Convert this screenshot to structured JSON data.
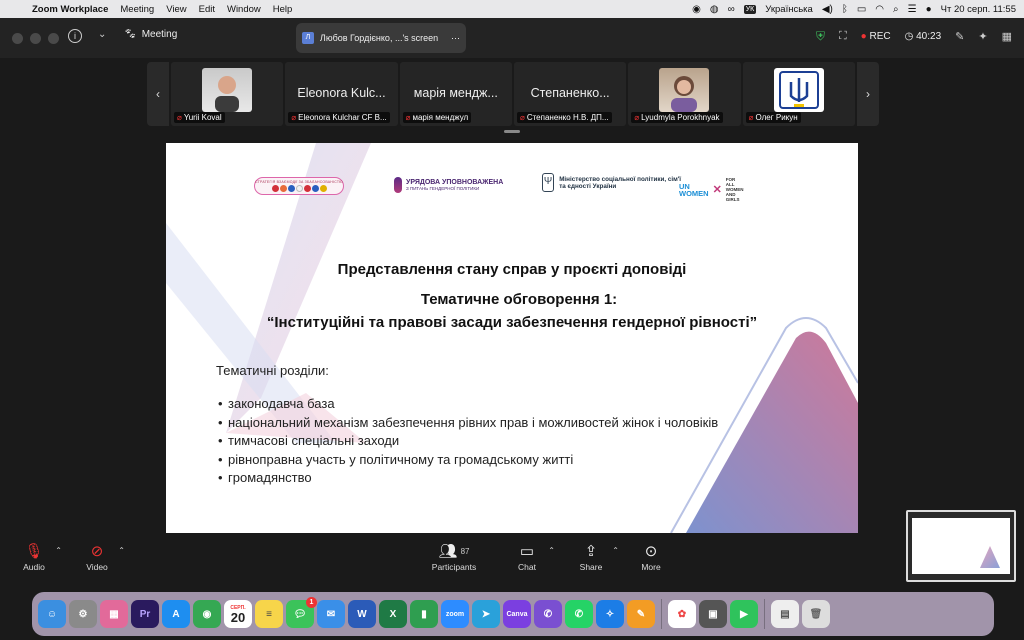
{
  "menubar": {
    "app_name": "Zoom Workplace",
    "items": [
      "Meeting",
      "View",
      "Edit",
      "Window",
      "Help"
    ],
    "keyboard_layout_badge": "УК",
    "keyboard_layout": "Українська",
    "datetime": "Чт 20 серп.  11:55"
  },
  "titlebar": {
    "meeting_label": "Meeting",
    "tab_title": "Любов Гордієнко, ...'s screen",
    "rec_label": "REC",
    "timer": "40:23"
  },
  "participants_strip": {
    "tiles": [
      {
        "display": "",
        "label": "Yurii Koval",
        "has_photo": true
      },
      {
        "display": "Eleonora Kulc...",
        "label": "Eleonora Kulchar CF B...",
        "has_photo": false
      },
      {
        "display": "марія мендж...",
        "label": "марія менджул",
        "has_photo": false
      },
      {
        "display": "Степаненко...",
        "label": "Степаненко Н.В. ДП...",
        "has_photo": false
      },
      {
        "display": "",
        "label": "Lyudmyla Porokhnyak",
        "has_photo": true
      },
      {
        "display": "",
        "label": "Олег Рикун",
        "has_photo": true
      }
    ]
  },
  "slide": {
    "logo_flags_text": "СТРАТЕГІЯ ВЗАЄМОДІЇ ЗА ЗБАЛАНСОВАНІСТЮ",
    "logo_gov_line1": "УРЯДОВА УПОВНОВАЖЕНА",
    "logo_gov_line2": "З ПИТАНЬ ГЕНДЕРНОЇ ПОЛІТИКИ",
    "logo_ministry": "Міністерство соціальної політики, сім'ї та єдності України",
    "logo_un_women": "UN WOMEN",
    "logo_for_all": "FOR ALL WOMEN AND GIRLS",
    "title_line1": "Представлення стану справ у проєкті доповіді",
    "title_line2": "Тематичне обговорення 1:",
    "title_line3": "“Інституційні та правові засади забезпечення гендерної рівності”",
    "sections_heading": "Тематичні розділи:",
    "bullets": [
      "законодавча база",
      "національний механізм забезпечення рівних прав і можливостей жінок і чоловіків",
      "тимчасові спеціальні заходи",
      "рівноправна участь у політичному та громадському житті",
      "громадянство"
    ]
  },
  "controls": {
    "audio": "Audio",
    "video": "Video",
    "participants": "Participants",
    "participants_count": "87",
    "chat": "Chat",
    "share": "Share",
    "more": "More"
  },
  "dock": {
    "calendar_month": "СЕРП.",
    "calendar_day": "20",
    "messages_badge": "1",
    "zoom_label": "zoom",
    "canva_label": "Canva",
    "premiere_label": "Pr",
    "colors": {
      "finder": "#3b8fe0",
      "premiere": "#2a1a5e",
      "appstore": "#1e8ef0",
      "whatsapp": "#25d366",
      "telegram": "#2aa1da",
      "word": "#2b5bb8",
      "excel": "#1f7a45",
      "viber": "#7a4fd1"
    }
  },
  "colors": {
    "rec_dot": "#e33333",
    "shield": "#3dbd5c",
    "muted_mic": "#e33333"
  }
}
